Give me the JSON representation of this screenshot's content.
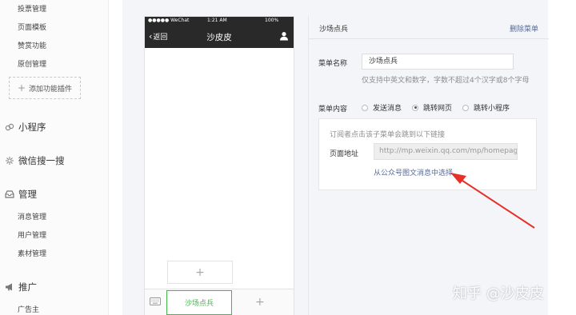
{
  "sidebar": {
    "top_items": [
      "投票管理",
      "页面模板",
      "赞赏功能",
      "原创管理"
    ],
    "add_plugin": "添加功能插件",
    "miniprogram": "小程序",
    "search": "微信搜一搜",
    "manage": {
      "title": "管理",
      "items": [
        "消息管理",
        "用户管理",
        "素材管理"
      ]
    },
    "promote": {
      "title": "推广",
      "items": [
        "广告主"
      ]
    }
  },
  "phone": {
    "carrier": "●●●●● WeChat",
    "time": "1:21 AM",
    "battery": "100%",
    "back": "返回",
    "title": "沙皮皮",
    "sub_add": "+",
    "menu_item": "沙场点兵",
    "menu_add": "+"
  },
  "editor": {
    "title": "沙场点兵",
    "delete": "删除菜单",
    "name_label": "菜单名称",
    "name_value": "沙场点兵",
    "name_hint": "仅支持中英文和数字，字数不超过4个汉字或8个字母",
    "content_label": "菜单内容",
    "options": [
      {
        "label": "发送消息",
        "selected": false
      },
      {
        "label": "跳转网页",
        "selected": true
      },
      {
        "label": "跳转小程序",
        "selected": false
      }
    ],
    "box_desc": "订阅者点击该子菜单会跳到以下链接",
    "url_label": "页面地址",
    "url_value": "http://mp.weixin.qq.com/mp/homepag",
    "pick_link": "从公众号图文消息中选择"
  },
  "watermark": "知乎 @沙皮皮",
  "colors": {
    "accent_green": "#44b549",
    "link_blue": "#576b95",
    "arrow_red": "#e8302a"
  }
}
